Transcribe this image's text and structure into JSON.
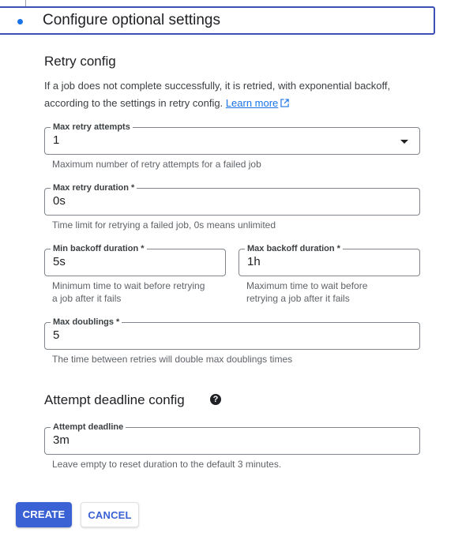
{
  "step": {
    "title": "Configure optional settings"
  },
  "retry": {
    "title": "Retry config",
    "description": "If a job does not complete successfully, it is retried, with exponential backoff, according to the settings in retry config.",
    "learn_more": "Learn more",
    "max_attempts": {
      "label": "Max retry attempts",
      "value": "1",
      "hint": "Maximum number of retry attempts for a failed job"
    },
    "max_duration": {
      "label": "Max retry duration *",
      "value": "0s",
      "hint": "Time limit for retrying a failed job, 0s means unlimited"
    },
    "min_backoff": {
      "label": "Min backoff duration *",
      "value": "5s",
      "hint_line1": "Minimum time to wait before retrying",
      "hint_line2": "a job after it fails"
    },
    "max_backoff": {
      "label": "Max backoff duration *",
      "value": "1h",
      "hint_line1": "Maximum time to wait before",
      "hint_line2": "retrying a job after it fails"
    },
    "max_doublings": {
      "label": "Max doublings *",
      "value": "5",
      "hint": "The time between retries will double max doublings times"
    }
  },
  "deadline": {
    "title": "Attempt deadline config",
    "help_icon": "?",
    "field": {
      "label": "Attempt deadline",
      "value": "3m",
      "hint": "Leave empty to reset duration to the default 3 minutes."
    }
  },
  "actions": {
    "create": "CREATE",
    "cancel": "CANCEL"
  },
  "colors": {
    "primary": "#3b62d4",
    "step_border": "#3c4fb5",
    "link": "#1a73e8"
  }
}
